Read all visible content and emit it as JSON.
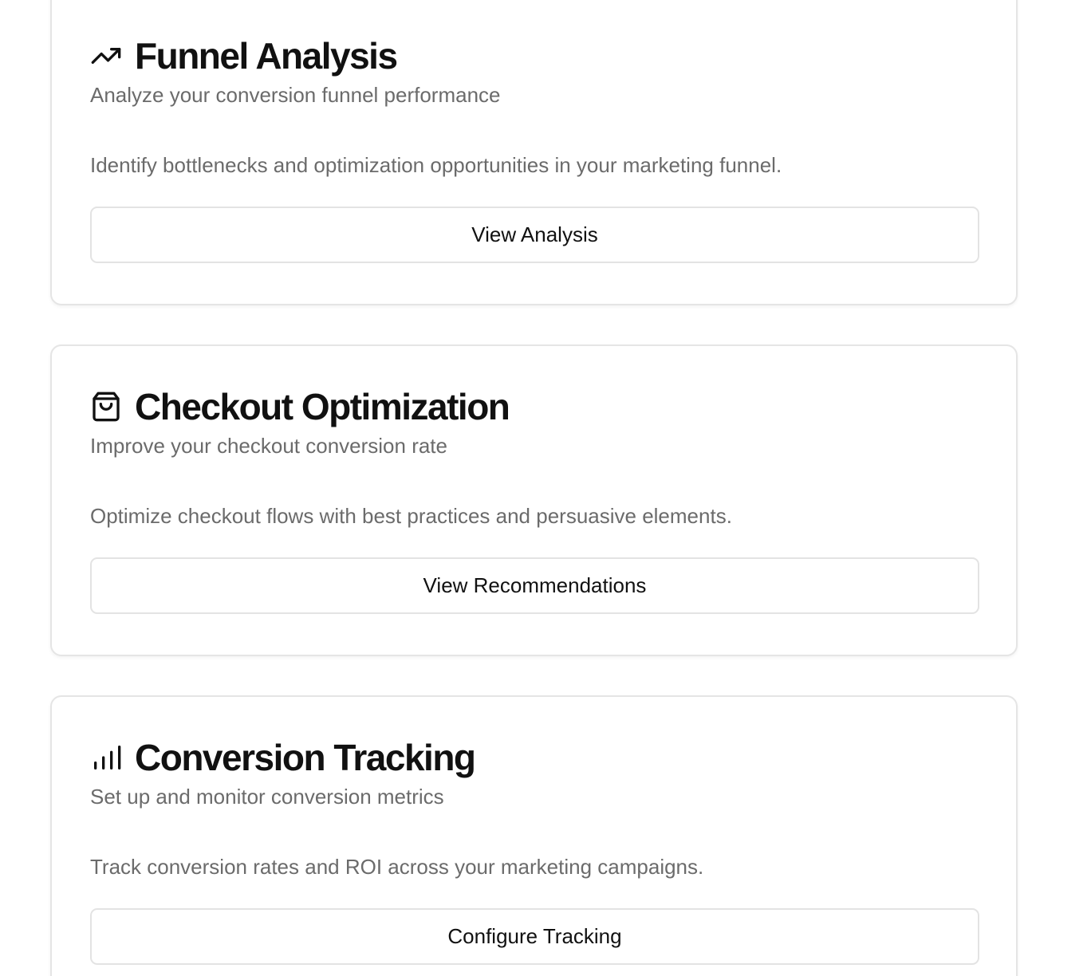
{
  "cards": [
    {
      "icon": "trending-up-icon",
      "title": "Funnel Analysis",
      "subtitle": "Analyze your conversion funnel performance",
      "description": "Identify bottlenecks and optimization opportunities in your marketing funnel.",
      "button_label": "View Analysis"
    },
    {
      "icon": "shopping-bag-icon",
      "title": "Checkout Optimization",
      "subtitle": "Improve your checkout conversion rate",
      "description": "Optimize checkout flows with best practices and persuasive elements.",
      "button_label": "View Recommendations"
    },
    {
      "icon": "bar-chart-icon",
      "title": "Conversion Tracking",
      "subtitle": "Set up and monitor conversion metrics",
      "description": "Track conversion rates and ROI across your marketing campaigns.",
      "button_label": "Configure Tracking"
    }
  ],
  "colors": {
    "title": "#111111",
    "muted_text": "#6b6b6b",
    "border": "#e5e5e5",
    "background": "#ffffff"
  }
}
